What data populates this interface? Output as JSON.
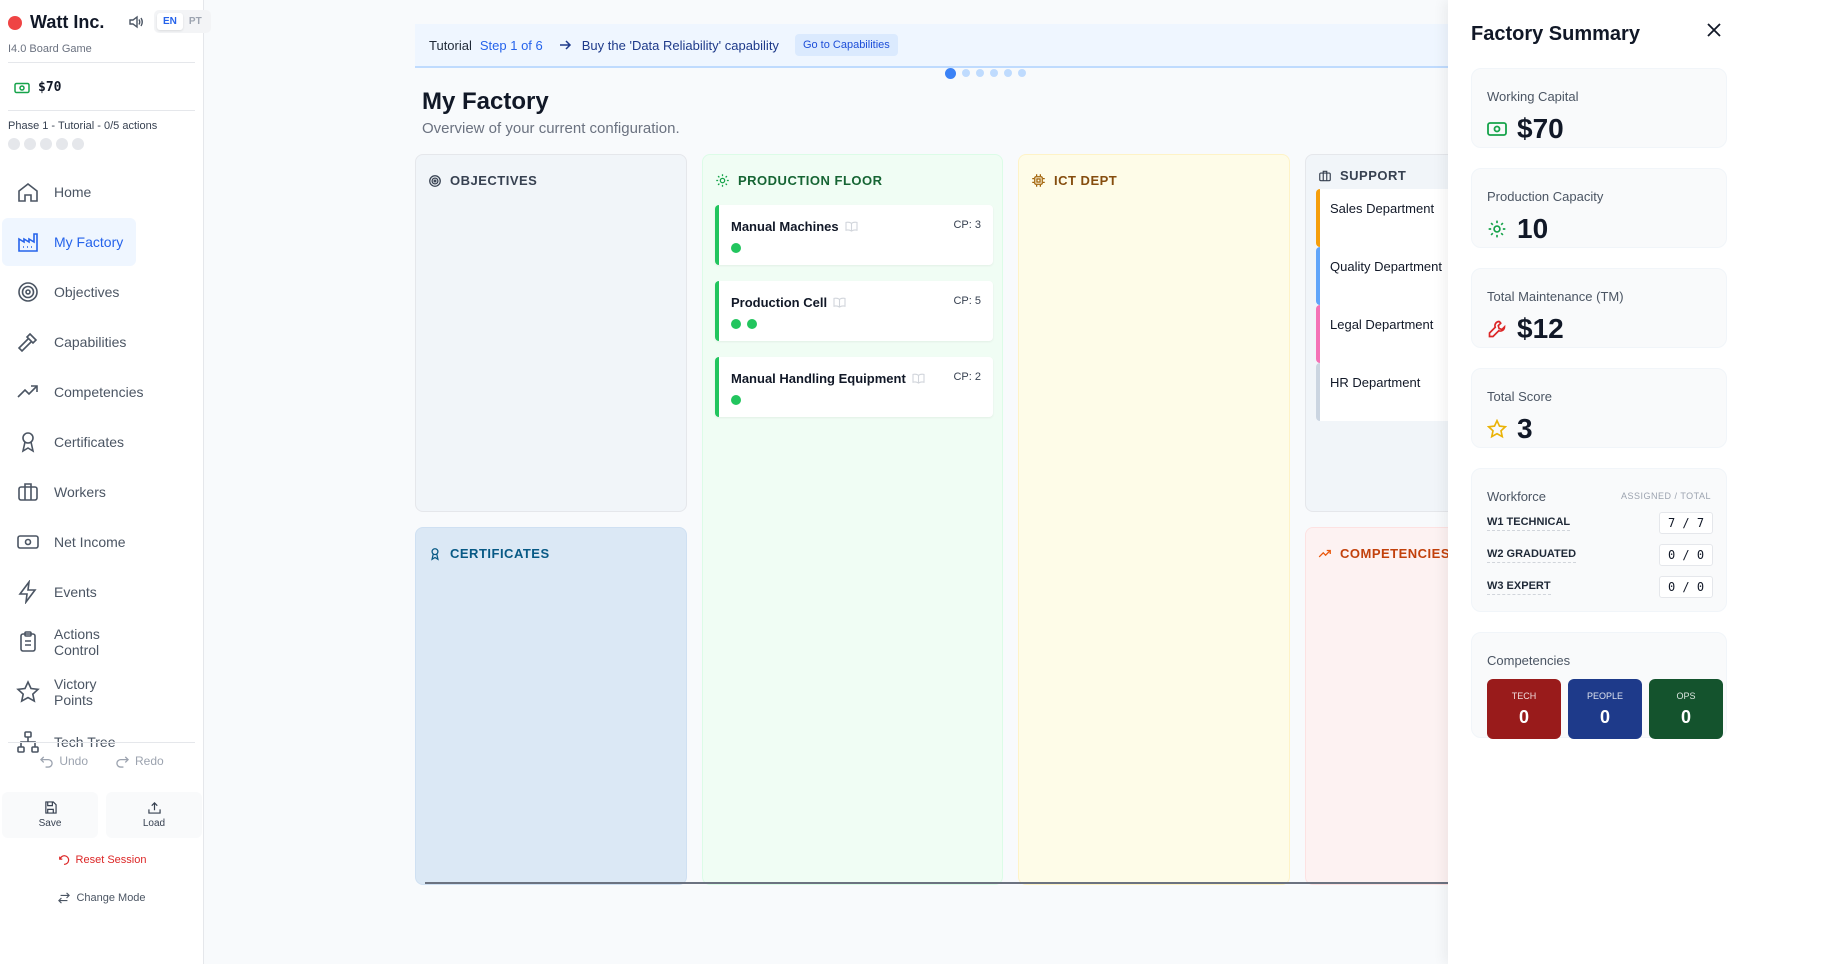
{
  "sidebar": {
    "brand": "Watt Inc.",
    "subtitle": "I4.0 Board Game",
    "lang": [
      "EN",
      "PT"
    ],
    "money": "$70",
    "phase": "Phase 1 - Tutorial - 0/5 actions",
    "nav": [
      {
        "label": "Home",
        "icon": "home-icon"
      },
      {
        "label": "My Factory",
        "icon": "factory-icon",
        "active": true
      },
      {
        "label": "Objectives",
        "icon": "target-icon"
      },
      {
        "label": "Capabilities",
        "icon": "hammer-icon"
      },
      {
        "label": "Competencies",
        "icon": "trending-up-icon"
      },
      {
        "label": "Certificates",
        "icon": "award-icon"
      },
      {
        "label": "Workers",
        "icon": "briefcase-icon"
      },
      {
        "label": "Net Income",
        "icon": "banknote-icon"
      },
      {
        "label": "Events",
        "icon": "lightning-icon"
      },
      {
        "label": "Actions Control",
        "icon": "clipboard-icon"
      },
      {
        "label": "Victory Points",
        "icon": "star-icon"
      },
      {
        "label": "Tech Tree",
        "icon": "network-icon"
      }
    ],
    "undo": "Undo",
    "redo": "Redo",
    "save": "Save",
    "load": "Load",
    "reset": "Reset Session",
    "change_mode": "Change Mode"
  },
  "tutorial": {
    "label": "Tutorial",
    "step": "Step 1 of 6",
    "task": "Buy the 'Data Reliability' capability",
    "button": "Go to Capabilities"
  },
  "main": {
    "title": "My Factory",
    "subtitle": "Overview of your current configuration."
  },
  "panels": {
    "objectives": "OBJECTIVES",
    "certificates": "CERTIFICATES",
    "production": "PRODUCTION FLOOR",
    "ict": "ICT DEPT",
    "support": "SUPPORT",
    "competencies": "COMPETENCIES"
  },
  "machines": [
    {
      "name": "Manual Machines",
      "cp": "CP: 3",
      "dots": 1
    },
    {
      "name": "Production Cell",
      "cp": "CP: 5",
      "dots": 2
    },
    {
      "name": "Manual Handling Equipment",
      "cp": "CP: 2",
      "dots": 1
    }
  ],
  "departments": [
    {
      "name": "Sales Department",
      "color": "#f59e0b"
    },
    {
      "name": "Quality Department",
      "color": "#60a5fa"
    },
    {
      "name": "Legal Department",
      "color": "#f472b6"
    },
    {
      "name": "HR Department",
      "color": "#cbd5e1"
    }
  ],
  "summary": {
    "title": "Factory Summary",
    "working_capital": {
      "label": "Working Capital",
      "value": "$70"
    },
    "production_capacity": {
      "label": "Production Capacity",
      "value": "10"
    },
    "total_maintenance": {
      "label": "Total Maintenance (TM)",
      "value": "$12"
    },
    "total_score": {
      "label": "Total Score",
      "value": "3"
    },
    "workforce": {
      "label": "Workforce",
      "header": "ASSIGNED / TOTAL",
      "rows": [
        {
          "name": "W1 TECHNICAL",
          "value": "7 / 7"
        },
        {
          "name": "W2 GRADUATED",
          "value": "0 / 0"
        },
        {
          "name": "W3 EXPERT",
          "value": "0 / 0"
        }
      ]
    },
    "competencies": {
      "label": "Competencies",
      "items": [
        {
          "name": "TECH",
          "value": "0",
          "color": "#991b1b"
        },
        {
          "name": "PEOPLE",
          "value": "0",
          "color": "#1e3a8a"
        },
        {
          "name": "OPS",
          "value": "0",
          "color": "#14532d"
        }
      ]
    }
  }
}
